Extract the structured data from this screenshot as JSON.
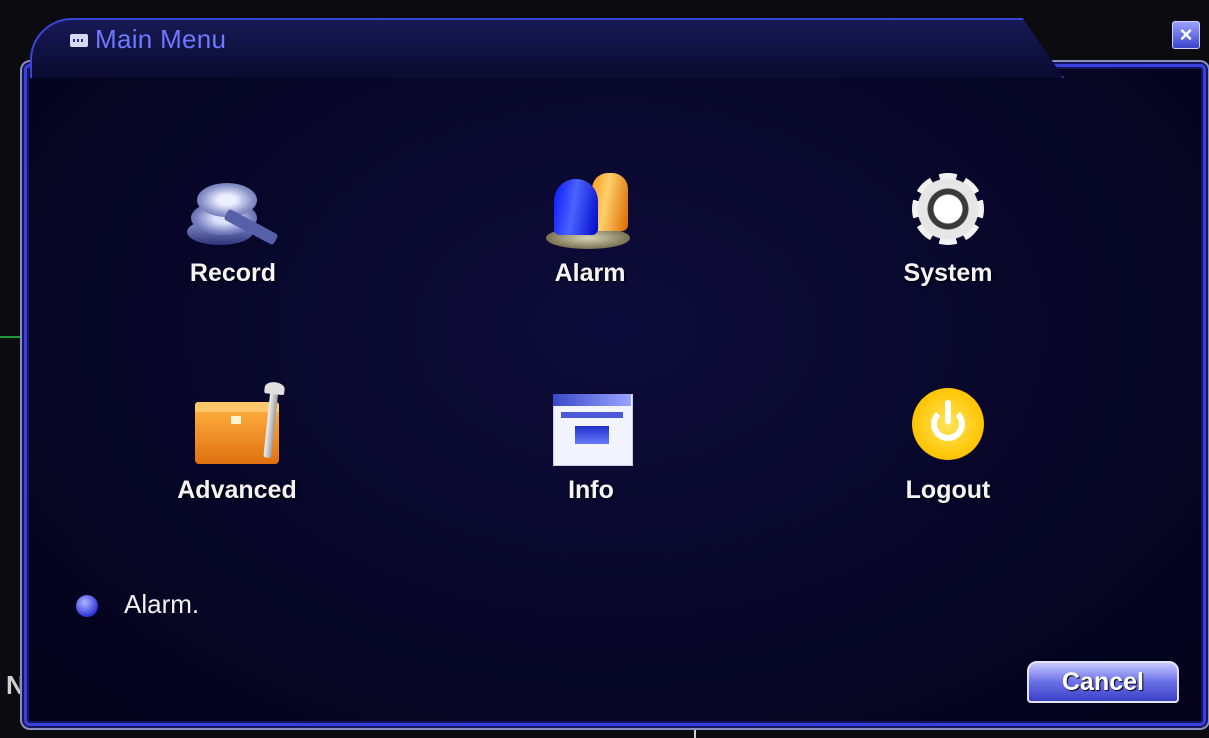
{
  "window": {
    "title": "Main Menu",
    "close_icon": "close-icon"
  },
  "menu": {
    "items": [
      {
        "label": "Record",
        "icon": "film-reel-icon"
      },
      {
        "label": "Alarm",
        "icon": "alarm-beacon-icon"
      },
      {
        "label": "System",
        "icon": "gear-icon"
      },
      {
        "label": "Advanced",
        "icon": "toolbox-icon"
      },
      {
        "label": "Info",
        "icon": "info-window-icon"
      },
      {
        "label": "Logout",
        "icon": "power-icon"
      }
    ]
  },
  "status": {
    "text": "Alarm."
  },
  "footer": {
    "cancel_label": "Cancel"
  },
  "background": {
    "corner_text": "N"
  },
  "colors": {
    "accent": "#3a40e0",
    "title": "#6f78ff",
    "panel": "#070628"
  }
}
